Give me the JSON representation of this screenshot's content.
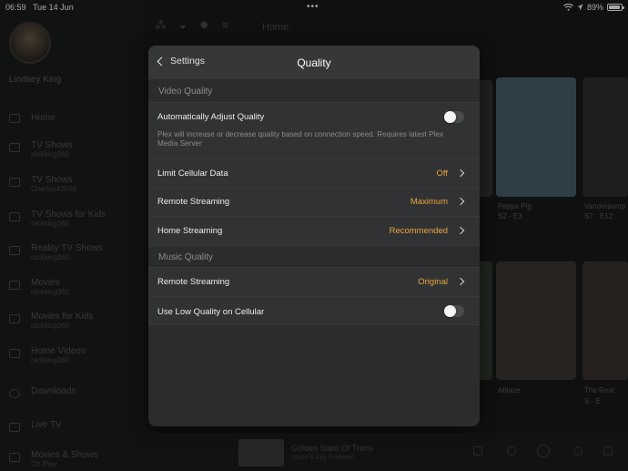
{
  "status_bar": {
    "time": "06:59",
    "date": "Tue 14 Jun",
    "battery_text": "89%",
    "battery_level": 0.89,
    "wifi_icon": "wifi-icon",
    "more_icon": "ellipsis-icon"
  },
  "sidebar": {
    "user_name": "Lindsey King",
    "items": [
      {
        "label": "Home",
        "sub": ""
      },
      {
        "label": "TV Shows",
        "sub": "nickking360"
      },
      {
        "label": "TV Shows",
        "sub": "Charles42F06"
      },
      {
        "label": "TV Shows for Kids",
        "sub": "nickking360"
      },
      {
        "label": "Reality TV Shows",
        "sub": "nickking360"
      },
      {
        "label": "Movies",
        "sub": "nickking360"
      },
      {
        "label": "Movies for Kids",
        "sub": "nickking360"
      },
      {
        "label": "Home Videos",
        "sub": "nickking360"
      },
      {
        "label": "Downloads",
        "sub": ""
      },
      {
        "label": "Live TV",
        "sub": ""
      },
      {
        "label": "Movies & Shows",
        "sub": "On Plex"
      }
    ]
  },
  "top_bar": {
    "home_label": "Home"
  },
  "content": {
    "captions": [
      "Peppa Pig",
      "Vanderpump",
      "Ablaze",
      "The Real"
    ],
    "caption_subs": [
      "S2 · E3",
      "S7 · E12",
      "",
      "S · E"
    ]
  },
  "player": {
    "title": "Golden State Of Trans",
    "subtitle": "Justin & Boy Freeman"
  },
  "colors": {
    "accent": "#e8a53a",
    "modal_bg": "#2b2c2e",
    "row_bg": "#313234"
  },
  "modal": {
    "back_label": "Settings",
    "title": "Quality",
    "video_section": "Video Quality",
    "auto_adjust_label": "Automatically Adjust Quality",
    "auto_adjust_on": false,
    "auto_adjust_desc": "Plex will increase or decrease quality based on connection speed. Requires latest Plex Media Server",
    "limit_cellular_label": "Limit Cellular Data",
    "limit_cellular_value": "Off",
    "video_remote_label": "Remote Streaming",
    "video_remote_value": "Maximum",
    "home_streaming_label": "Home Streaming",
    "home_streaming_value": "Recommended",
    "music_section": "Music Quality",
    "music_remote_label": "Remote Streaming",
    "music_remote_value": "Original",
    "low_quality_label": "Use Low Quality on Cellular",
    "low_quality_on": false
  }
}
